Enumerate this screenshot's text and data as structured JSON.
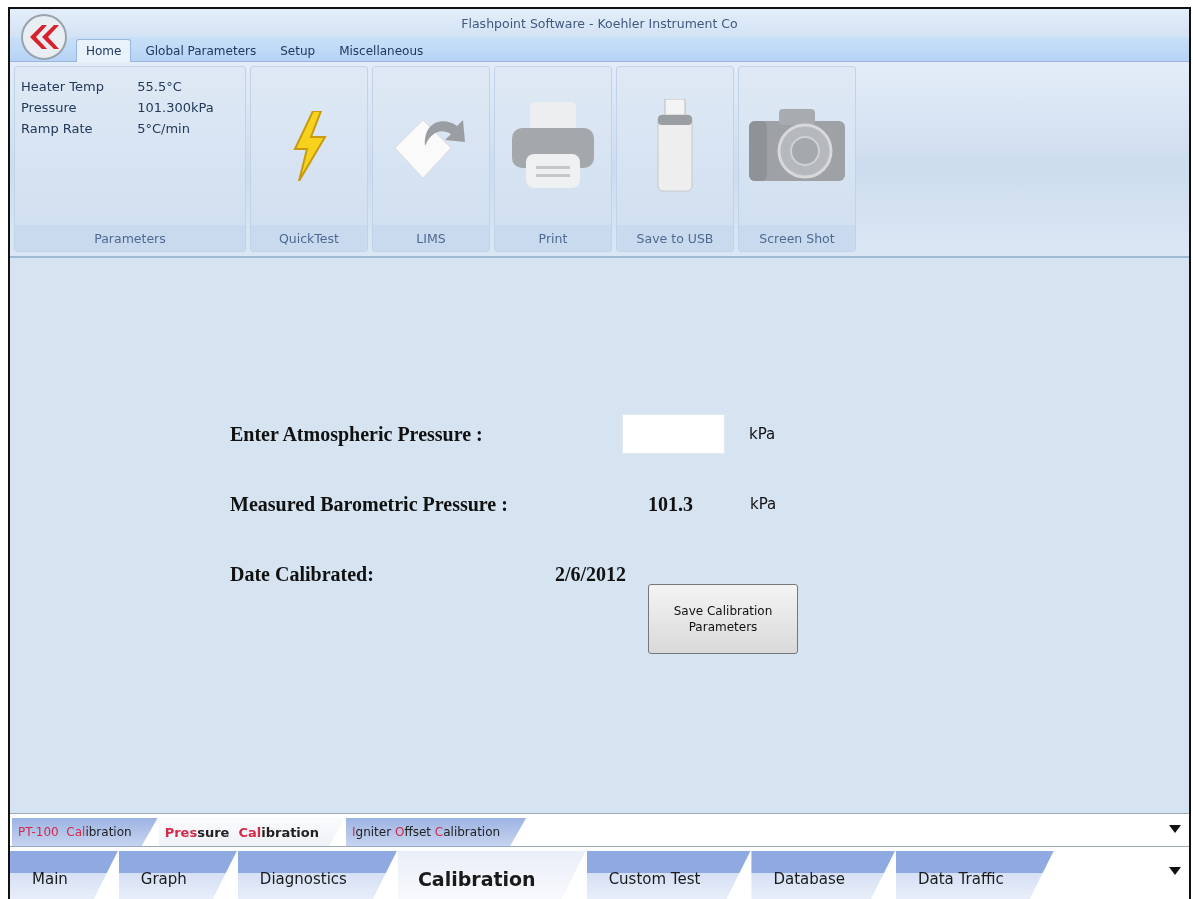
{
  "window": {
    "title": "Flashpoint Software - Koehler Instrument Co"
  },
  "ribbon_tabs": [
    {
      "label": "Home",
      "selected": true
    },
    {
      "label": "Global Parameters",
      "selected": false
    },
    {
      "label": "Setup",
      "selected": false
    },
    {
      "label": "Miscellaneous",
      "selected": false
    }
  ],
  "parameters": {
    "group_label": "Parameters",
    "rows": [
      {
        "name": "Heater Temp",
        "value": "55.5°C"
      },
      {
        "name": "Pressure",
        "value": "101.300kPa"
      },
      {
        "name": "Ramp Rate",
        "value": "5°C/min"
      }
    ]
  },
  "ribbon_buttons": [
    {
      "kind": "bolt",
      "label": "QuickTest"
    },
    {
      "kind": "lims",
      "label": "LIMS"
    },
    {
      "kind": "printer",
      "label": "Print"
    },
    {
      "kind": "usb",
      "label": "Save to USB"
    },
    {
      "kind": "camera",
      "label": "Screen Shot"
    }
  ],
  "form": {
    "rows": [
      {
        "kind": "input",
        "label": "Enter Atmospheric Pressure :",
        "unit": "kPa"
      },
      {
        "kind": "value",
        "label": "Measured Barometric Pressure :",
        "value": "101.3",
        "unit": "kPa"
      },
      {
        "kind": "value",
        "label": "Date Calibrated:",
        "value": "2/6/2012"
      }
    ],
    "save_button": "Save Calibration Parameters"
  },
  "sub_tabs": [
    {
      "selected": false,
      "parts": [
        {
          "text": "PT-100  Cal",
          "highlight": true
        },
        {
          "text": "ibration",
          "highlight": false
        }
      ]
    },
    {
      "selected": true,
      "parts": [
        {
          "text": "Pres",
          "highlight": true
        },
        {
          "text": "sure  ",
          "highlight": false
        },
        {
          "text": "Cal",
          "highlight": true
        },
        {
          "text": "ibration",
          "highlight": false
        }
      ]
    },
    {
      "selected": false,
      "parts": [
        {
          "text": "I",
          "highlight": true
        },
        {
          "text": "gniter ",
          "highlight": false
        },
        {
          "text": "O",
          "highlight": true
        },
        {
          "text": "ffset ",
          "highlight": false
        },
        {
          "text": "C",
          "highlight": true
        },
        {
          "text": "alibration",
          "highlight": false
        }
      ]
    }
  ],
  "main_tabs": [
    {
      "label": "Main",
      "selected": false
    },
    {
      "label": "Graph",
      "selected": false
    },
    {
      "label": "Diagnostics",
      "selected": false
    },
    {
      "label": "Calibration",
      "selected": true
    },
    {
      "label": "Custom Test",
      "selected": false
    },
    {
      "label": "Database",
      "selected": false
    },
    {
      "label": "Data Traffic",
      "selected": false
    }
  ]
}
